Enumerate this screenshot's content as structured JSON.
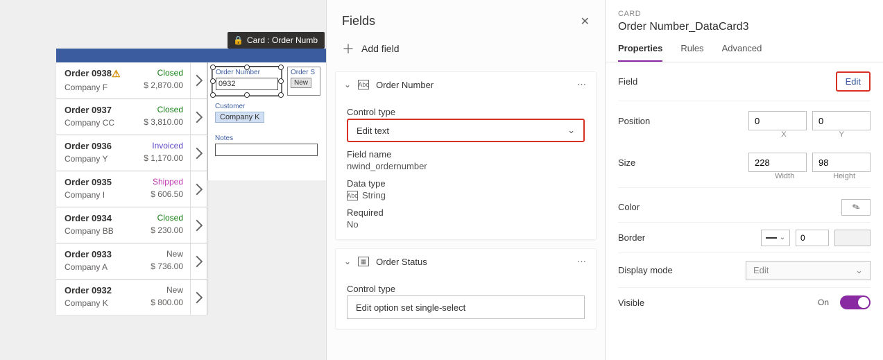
{
  "tooltip": {
    "label": "Card : Order Numb"
  },
  "orders": [
    {
      "title": "Order 0938",
      "company": "Company F",
      "status": "Closed",
      "price": "$ 2,870.00",
      "warn": true
    },
    {
      "title": "Order 0937",
      "company": "Company CC",
      "status": "Closed",
      "price": "$ 3,810.00"
    },
    {
      "title": "Order 0936",
      "company": "Company Y",
      "status": "Invoiced",
      "price": "$ 1,170.00"
    },
    {
      "title": "Order 0935",
      "company": "Company I",
      "status": "Shipped",
      "price": "$ 606.50"
    },
    {
      "title": "Order 0934",
      "company": "Company BB",
      "status": "Closed",
      "price": "$ 230.00"
    },
    {
      "title": "Order 0933",
      "company": "Company A",
      "status": "New",
      "price": "$ 736.00"
    },
    {
      "title": "Order 0932",
      "company": "Company K",
      "status": "New",
      "price": "$ 800.00"
    }
  ],
  "form": {
    "orderNumber": {
      "label": "Order Number",
      "value": "0932"
    },
    "orderStatus": {
      "label": "Order S",
      "badge": "New"
    },
    "customer": {
      "label": "Customer",
      "value": "Company K"
    },
    "notes": {
      "label": "Notes",
      "value": ""
    }
  },
  "fields": {
    "title": "Fields",
    "addField": "Add field",
    "groups": [
      {
        "name": "Order Number",
        "controlTypeLabel": "Control type",
        "controlType": "Edit text",
        "fieldNameLabel": "Field name",
        "fieldName": "nwind_ordernumber",
        "dataTypeLabel": "Data type",
        "dataType": "String",
        "requiredLabel": "Required",
        "required": "No",
        "typeIcon": "Abc"
      },
      {
        "name": "Order Status",
        "controlTypeLabel": "Control type",
        "controlType": "Edit option set single-select",
        "typeIcon": "grid"
      }
    ]
  },
  "props": {
    "overline": "CARD",
    "title": "Order Number_DataCard3",
    "tabs": {
      "properties": "Properties",
      "rules": "Rules",
      "advanced": "Advanced"
    },
    "labels": {
      "field": "Field",
      "edit": "Edit",
      "position": "Position",
      "x": "X",
      "y": "Y",
      "size": "Size",
      "width": "Width",
      "height": "Height",
      "color": "Color",
      "border": "Border",
      "displayMode": "Display mode",
      "visible": "Visible",
      "on": "On"
    },
    "values": {
      "posX": "0",
      "posY": "0",
      "width": "228",
      "height": "98",
      "borderWidth": "0",
      "displayMode": "Edit"
    }
  }
}
